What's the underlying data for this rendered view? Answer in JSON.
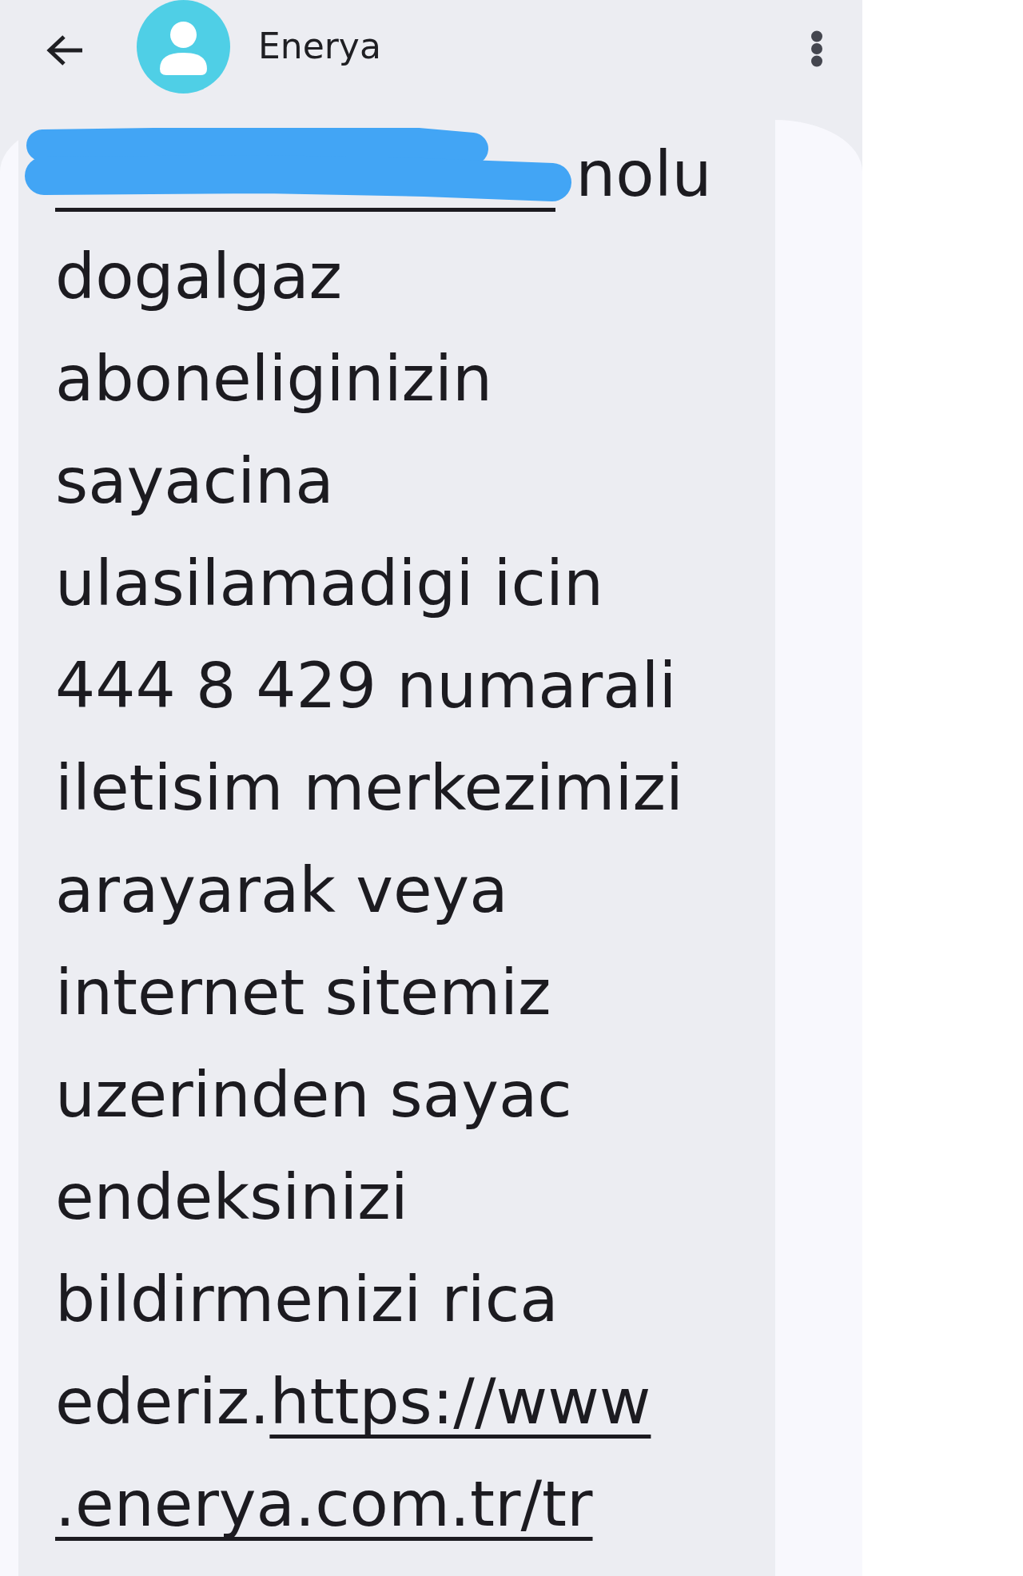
{
  "header": {
    "title": "Enerya"
  },
  "message": {
    "lines": [
      [
        {
          "kind": "redacted"
        },
        {
          "kind": "text",
          "text": "nolu"
        }
      ],
      [
        {
          "kind": "text",
          "text": "dogalgaz"
        }
      ],
      [
        {
          "kind": "text",
          "text": "aboneliginizin"
        }
      ],
      [
        {
          "kind": "text",
          "text": "sayacina"
        }
      ],
      [
        {
          "kind": "text",
          "text": "ulasilamadigi icin"
        }
      ],
      [
        {
          "kind": "text",
          "text": "444 8 429 numarali"
        }
      ],
      [
        {
          "kind": "text",
          "text": "iletisim merkezimizi"
        }
      ],
      [
        {
          "kind": "text",
          "text": "arayarak veya"
        }
      ],
      [
        {
          "kind": "text",
          "text": "internet sitemiz"
        }
      ],
      [
        {
          "kind": "text",
          "text": "uzerinden sayac"
        }
      ],
      [
        {
          "kind": "text",
          "text": "endeksinizi"
        }
      ],
      [
        {
          "kind": "text",
          "text": "bildirmenizi rica"
        }
      ],
      [
        {
          "kind": "text",
          "text": "ederiz."
        },
        {
          "kind": "link",
          "text": "https://www"
        }
      ],
      [
        {
          "kind": "link",
          "text": ".enerya.com.tr/tr"
        }
      ]
    ]
  }
}
